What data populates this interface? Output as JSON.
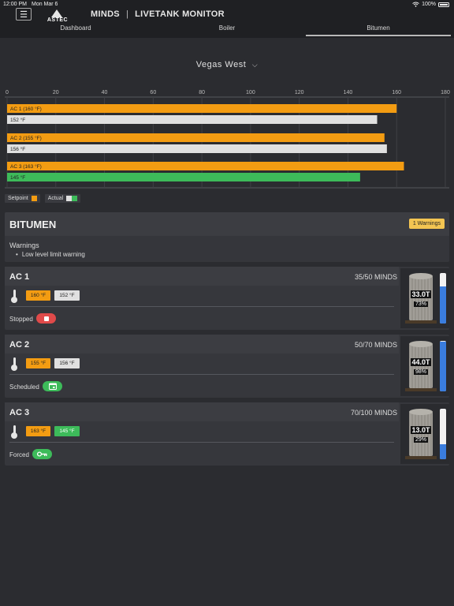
{
  "status_bar": {
    "time": "12:00 PM",
    "date": "Mon Mar 6",
    "battery": "100%"
  },
  "header": {
    "menu_glyph": "☰",
    "logo_text": "ASTEC",
    "title_left": "MINDS",
    "separator": "|",
    "title_right": "LIVETANK MONITOR"
  },
  "tabs": [
    {
      "label": "Dashboard",
      "active": false
    },
    {
      "label": "Boiler",
      "active": false
    },
    {
      "label": "Bitumen",
      "active": true
    }
  ],
  "location": {
    "label": "Vegas West",
    "chevron": "⌵"
  },
  "chart_data": {
    "type": "bar",
    "orientation": "horizontal",
    "xlim": [
      0,
      180
    ],
    "ticks": [
      "0",
      "20",
      "40",
      "60",
      "80",
      "100",
      "120",
      "140",
      "160",
      "180"
    ],
    "grid": true,
    "legend_placement": "bottom-left",
    "groups": [
      {
        "setpoint_label": "AC 1 (160 °F)",
        "setpoint": 160,
        "actual_label": "152 °F",
        "actual": 152,
        "actual_color": "#e0e0e0"
      },
      {
        "setpoint_label": "AC 2 (155 °F)",
        "setpoint": 155,
        "actual_label": "156 °F",
        "actual": 156,
        "actual_color": "#e0e0e0"
      },
      {
        "setpoint_label": "AC 3 (163 °F)",
        "setpoint": 163,
        "actual_label": "145 °F",
        "actual": 145,
        "actual_color": "#3dbb5a"
      }
    ],
    "setpoint_color": "#f39c12"
  },
  "legend": {
    "setpoint": "Setpoint",
    "actual": "Actual"
  },
  "bitumen": {
    "title": "BITUMEN",
    "warnings_badge": "1 Warnings",
    "warnings_label": "Warnings",
    "warnings": [
      "Low level limit warning"
    ]
  },
  "tanks": [
    {
      "name": "AC 1",
      "minds": "35/50 MINDS",
      "setpoint": "160 °F",
      "actual": "152 °F",
      "actual_color": "#e0e0e0",
      "status": "Stopped",
      "status_color": "#e04a4a",
      "status_icon": "stop-icon",
      "tons": "33.0T",
      "percent": "73%",
      "level": 0.73
    },
    {
      "name": "AC 2",
      "minds": "50/70 MINDS",
      "setpoint": "155 °F",
      "actual": "156 °F",
      "actual_color": "#e0e0e0",
      "status": "Scheduled",
      "status_color": "#3dbb5a",
      "status_icon": "calendar-icon",
      "tons": "44.0T",
      "percent": "98%",
      "level": 0.98
    },
    {
      "name": "AC 3",
      "minds": "70/100 MINDS",
      "setpoint": "163 °F",
      "actual": "145 °F",
      "actual_color": "#3dbb5a",
      "status": "Forced",
      "status_color": "#3dbb5a",
      "status_icon": "key-icon",
      "tons": "13.0T",
      "percent": "29%",
      "level": 0.29
    }
  ],
  "colors": {
    "background": "#2b2c30",
    "header": "#1f2023",
    "gauge": "#3a7dde",
    "warning": "#f3c552"
  }
}
